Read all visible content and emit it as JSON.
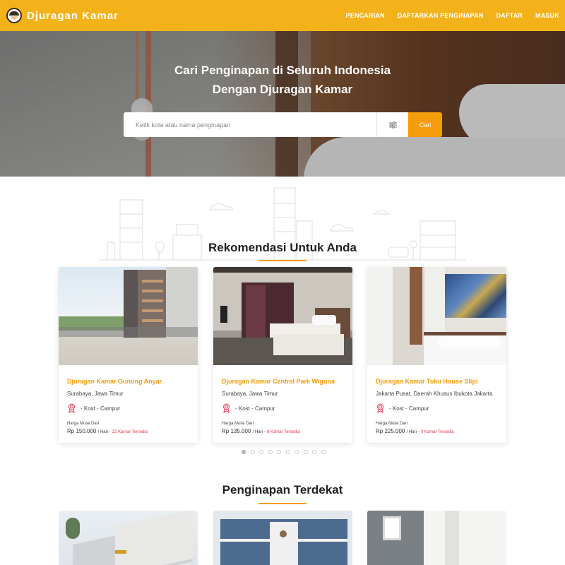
{
  "navbar": {
    "brand": "Djuragan Kamar",
    "links": [
      "PENCARIAN",
      "DAFTARKAN PENGINAPAN",
      "DAFTAR",
      "MASUK"
    ]
  },
  "hero": {
    "title_line1": "Cari Penginapan di Seluruh Indonesia",
    "title_line2": "Dengan Djuragan Kamar",
    "search_placeholder": "Ketik kota atau nama penginapan",
    "search_button": "Cari"
  },
  "recommendations": {
    "title": "Rekomendasi Untuk Anda",
    "cards": [
      {
        "name": "Djuragan Kamar Gunung Anyar",
        "location": "Surabaya, Jawa Timur",
        "type": "- Kost - Campur",
        "price_label": "Harga Mulai Dari",
        "price": "Rp 150.000",
        "per": "/ Hari -",
        "availability": "22 Kamar Tersedia"
      },
      {
        "name": "Djuragan Kamar Central Park Wiguna",
        "location": "Surabaya, Jawa Timur",
        "type": "- Kost - Campur",
        "price_label": "Harga Mulai Dari",
        "price": "Rp 135.000",
        "per": "/ Hari -",
        "availability": "8 Kamar Tersedia"
      },
      {
        "name": "Djuragan Kamar Toku House Slipi",
        "location": "Jakarta Pusat, Daerah Khusus Ibukota Jakarta",
        "type": "- Kost - Campur",
        "price_label": "Harga Mulai Dari",
        "price": "Rp 225.000",
        "per": "/ Hari -",
        "availability": "0 Kamar Tersedia"
      }
    ],
    "carousel": {
      "total_dots": 10,
      "active_index": 0
    }
  },
  "nearby": {
    "title": "Penginapan Terdekat"
  },
  "colors": {
    "brand_yellow": "#f4b21a",
    "accent_orange": "#f59c0b",
    "availability_red": "#e8384f"
  }
}
